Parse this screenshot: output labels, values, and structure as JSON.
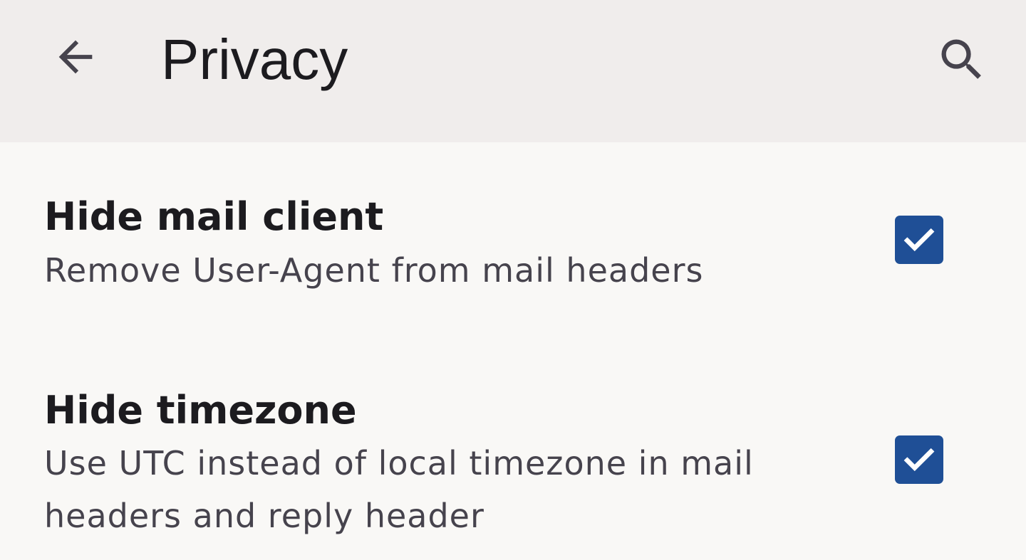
{
  "app_bar": {
    "title": "Privacy",
    "back_icon": "arrow-back-icon",
    "search_icon": "search-icon",
    "background": "#f0edec"
  },
  "preferences": [
    {
      "title": "Hide mail client",
      "summary": "Remove User-Agent from mail headers",
      "checked": true
    },
    {
      "title": "Hide timezone",
      "summary": "Use UTC instead of local timezone in mail headers and reply header",
      "checked": true
    }
  ],
  "colors": {
    "checkbox_accent": "#1f4f96",
    "page_background": "#f9f8f6",
    "summary_text": "#46434d"
  }
}
